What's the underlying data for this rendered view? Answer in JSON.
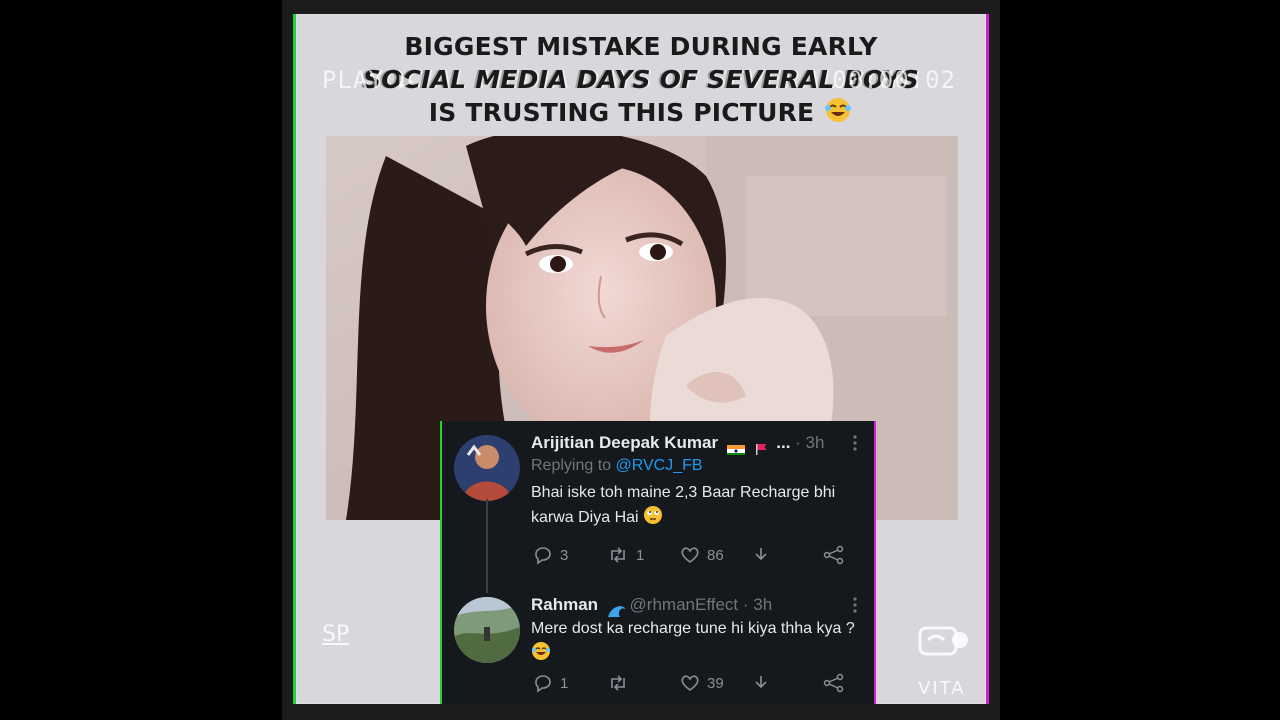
{
  "headline": {
    "line1": "BIGGEST MISTAKE DURING EARLY",
    "line2": "SOCIAL MEDIA DAYS OF SEVERAL BOYS",
    "line3": "IS TRUSTING THIS PICTURE"
  },
  "overlay": {
    "vhs_play": "PLAY ▶",
    "vhs_time": "00:00:02",
    "watermark_left": "SP",
    "watermark_right": "VITA"
  },
  "tweets": [
    {
      "name": "Arijitian Deepak Kumar",
      "name_suffix": "...",
      "time": "· 3h",
      "replying_label": "Replying to",
      "replying_to": "@RVCJ_FB",
      "text": "Bhai iske toh maine 2,3 Baar Recharge bhi karwa Diya Hai",
      "emoji": "🙄",
      "replies": "3",
      "retweets": "1",
      "likes": "86"
    },
    {
      "name": "Rahman",
      "handle": "@rhmanEffect",
      "time": "· 3h",
      "text": "Mere dost ka recharge tune hi kiya thha kya ?",
      "emoji": "😂",
      "replies": "1",
      "retweets": "",
      "likes": "39"
    }
  ],
  "colors": {
    "card_bg": "#15181c",
    "link": "#1d9bf0",
    "muted": "#71767b",
    "glitch_green": "#1fd62f",
    "glitch_magenta": "#d21fd9"
  }
}
